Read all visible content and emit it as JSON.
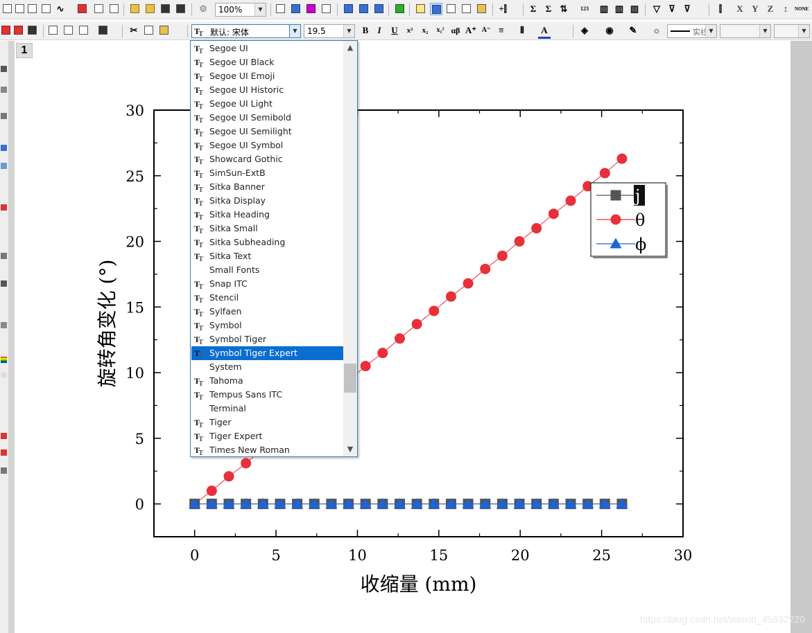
{
  "toolbar": {
    "zoom": "100%",
    "font_name": "默认: 宋体",
    "font_size": "19.5",
    "bold_label": "B",
    "italic_label": "I",
    "underline_label": "U",
    "superscript_label": "x²",
    "subscript_label": "x₂",
    "supsub_label": "x₁²",
    "greek_label": "αβ",
    "line_style_label": "实线"
  },
  "page": {
    "number": "1"
  },
  "font_dropdown": {
    "items": [
      {
        "name": "Segoe UI",
        "truetype": true
      },
      {
        "name": "Segoe UI Black",
        "truetype": true
      },
      {
        "name": "Segoe UI Emoji",
        "truetype": true
      },
      {
        "name": "Segoe UI Historic",
        "truetype": true
      },
      {
        "name": "Segoe UI Light",
        "truetype": true
      },
      {
        "name": "Segoe UI Semibold",
        "truetype": true
      },
      {
        "name": "Segoe UI Semilight",
        "truetype": true
      },
      {
        "name": "Segoe UI Symbol",
        "truetype": true
      },
      {
        "name": "Showcard Gothic",
        "truetype": true
      },
      {
        "name": "SimSun-ExtB",
        "truetype": true
      },
      {
        "name": "Sitka Banner",
        "truetype": true
      },
      {
        "name": "Sitka Display",
        "truetype": true
      },
      {
        "name": "Sitka Heading",
        "truetype": true
      },
      {
        "name": "Sitka Small",
        "truetype": true
      },
      {
        "name": "Sitka Subheading",
        "truetype": true
      },
      {
        "name": "Sitka Text",
        "truetype": true
      },
      {
        "name": "Small Fonts",
        "truetype": false
      },
      {
        "name": "Snap ITC",
        "truetype": true
      },
      {
        "name": "Stencil",
        "truetype": true
      },
      {
        "name": "Sylfaen",
        "truetype": true
      },
      {
        "name": "Symbol",
        "truetype": true
      },
      {
        "name": "Symbol Tiger",
        "truetype": true
      },
      {
        "name": "Symbol Tiger Expert",
        "truetype": true
      },
      {
        "name": "System",
        "truetype": false
      },
      {
        "name": "Tahoma",
        "truetype": true
      },
      {
        "name": "Tempus Sans ITC",
        "truetype": true
      },
      {
        "name": "Terminal",
        "truetype": false
      },
      {
        "name": "Tiger",
        "truetype": true
      },
      {
        "name": "Tiger Expert",
        "truetype": true
      },
      {
        "name": "Times New Roman",
        "truetype": true
      }
    ],
    "selected": "Symbol Tiger Expert"
  },
  "chart_data": {
    "type": "line",
    "xlabel": "收缩量 (mm)",
    "ylabel": "旋转角变化 (°)",
    "xlim": [
      -2.5,
      30
    ],
    "ylim": [
      -2.5,
      30
    ],
    "xticks": [
      0,
      5,
      10,
      15,
      20,
      25,
      30
    ],
    "yticks": [
      0,
      5,
      10,
      15,
      20,
      25,
      30
    ],
    "legend_position": "top-right",
    "x": [
      0,
      1.05,
      2.1,
      3.15,
      4.2,
      5.25,
      6.3,
      7.35,
      8.4,
      9.45,
      10.5,
      11.55,
      12.6,
      13.65,
      14.7,
      15.75,
      16.8,
      17.85,
      18.9,
      19.95,
      21.0,
      22.05,
      23.1,
      24.15,
      25.2,
      26.25
    ],
    "series": [
      {
        "name": "j",
        "color": "#555555",
        "marker": "square",
        "values": [
          0,
          0,
          0,
          0,
          0,
          0,
          0,
          0,
          0,
          0,
          0,
          0,
          0,
          0,
          0,
          0,
          0,
          0,
          0,
          0,
          0,
          0,
          0,
          0,
          0,
          0
        ]
      },
      {
        "name": "θ",
        "color": "#e8303a",
        "marker": "circle",
        "values": [
          0,
          1.0,
          2.1,
          3.1,
          4.2,
          5.2,
          6.3,
          7.3,
          8.4,
          9.4,
          10.5,
          11.5,
          12.6,
          13.7,
          14.7,
          15.8,
          16.8,
          17.9,
          18.9,
          20.0,
          21.0,
          22.1,
          23.1,
          24.2,
          25.2,
          26.3
        ]
      },
      {
        "name": "ϕ",
        "color": "#1f63d6",
        "marker": "triangle",
        "values": [
          0,
          0,
          0,
          0,
          0,
          0,
          0,
          0,
          0,
          0,
          0,
          0,
          0,
          0,
          0,
          0,
          0,
          0,
          0,
          0,
          0,
          0,
          0,
          0,
          0,
          0
        ]
      }
    ]
  },
  "watermark": "https://blog.csdn.net/weixin_45632220",
  "colors": {
    "toolbar_bg": "#f0f0f0",
    "selection": "#0a6ed1",
    "dropdown_border": "#3c7fb1"
  }
}
